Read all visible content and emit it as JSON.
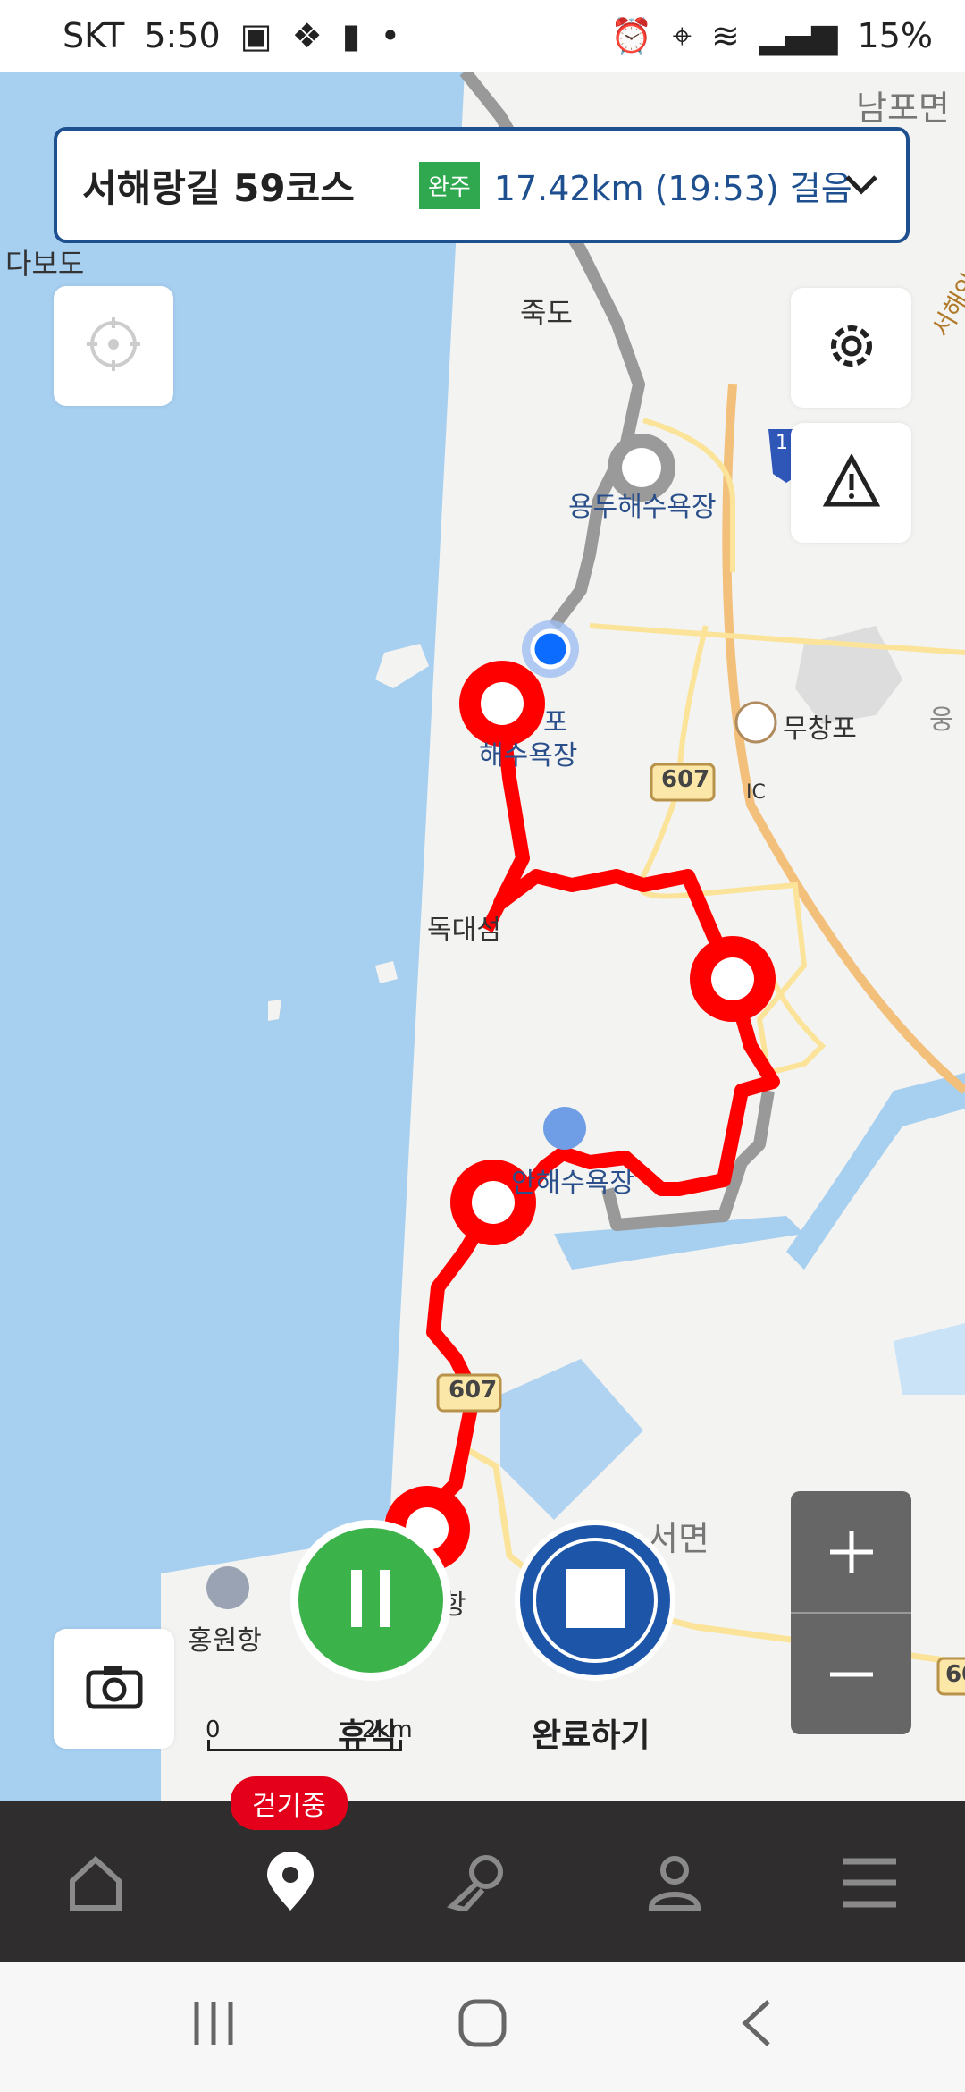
{
  "status_bar": {
    "carrier": "SKT",
    "time": "5:50",
    "battery": "15%"
  },
  "course": {
    "name": "서해랑길 59코스",
    "badge": "완주",
    "distance": "17.42km",
    "duration": "(19:53)",
    "mode": "걸음"
  },
  "map_labels": {
    "namposmyeon": "남포면",
    "dabodo": "다보도",
    "jukdo": "죽도",
    "yongdu_beach": "용두해수욕장",
    "beach2_a": "포",
    "beach2_b": "해수욕장",
    "muchangpo": "무창포",
    "ic": "IC",
    "road_607_a": "607",
    "road_607_b": "607",
    "road_60": "60",
    "interstate": "1",
    "road_side": "서해안",
    "dokdaeseom": "독대섬",
    "beach3": "안해수욕장",
    "seomyeon": "서면",
    "hongwonhang": "홍원항",
    "hang_partial": "항",
    "ung": "웅"
  },
  "scale": {
    "zero": "0",
    "dist": "2km"
  },
  "controls": {
    "pause_label": "휴식",
    "finish_label": "완료하기"
  },
  "nav": {
    "walking_badge": "걷기중"
  },
  "colors": {
    "route": "#ff0000",
    "progress": "#0b6cff",
    "pause": "#3cb34a",
    "finish": "#1d56a8"
  },
  "icons": [
    "locate-icon",
    "gear-icon",
    "warning-icon",
    "camera-icon",
    "pause-icon",
    "stop-icon",
    "home-icon",
    "map-pin-icon",
    "course-icon",
    "profile-icon",
    "menu-icon"
  ]
}
